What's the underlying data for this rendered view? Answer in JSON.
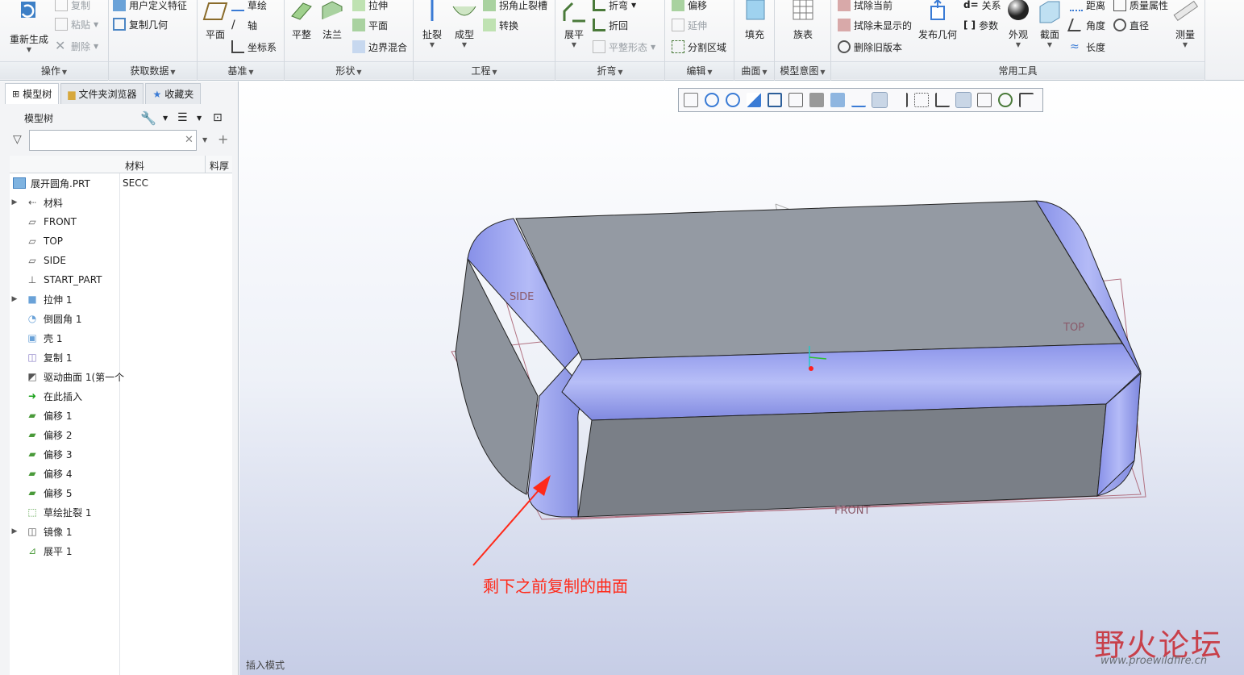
{
  "ribbon": {
    "groups": {
      "operations": "操作",
      "get_data": "获取数据",
      "datum": "基准",
      "shapes": "形状",
      "engineering": "工程",
      "bends": "折弯",
      "editing": "编辑",
      "surfaces": "曲面",
      "model_intent": "模型意图",
      "common_tools": "常用工具"
    },
    "operations": {
      "regenerate": "重新生成",
      "copy": "复制",
      "paste": "粘贴",
      "delete": "删除"
    },
    "get_data": {
      "udf": "用户定义特征",
      "copy_geom": "复制几何"
    },
    "datum": {
      "plane": "平面",
      "axis": "轴",
      "csys": "坐标系",
      "sketch": "草绘"
    },
    "shapes": {
      "flat": "平整",
      "flange": "法兰",
      "extrude": "拉伸",
      "planar": "平面",
      "boundary_blend": "边界混合"
    },
    "engineering": {
      "rip": "扯裂",
      "form": "成型",
      "corner_relief": "拐角止裂槽",
      "convert": "转换"
    },
    "bends": {
      "unbend": "展平",
      "bend": "折弯",
      "bend_back": "折回",
      "flat_state": "平整形态"
    },
    "editing": {
      "offset": "偏移",
      "extend": "延伸",
      "split_area": "分割区域"
    },
    "surfaces": {
      "fill": "填充"
    },
    "model_intent": {
      "family_table": "族表"
    },
    "common_tools": {
      "erase_current": "拭除当前",
      "erase_not_displayed": "拭除未显示的",
      "delete_old_versions": "删除旧版本",
      "publish_geom": "发布几何",
      "relations": "关系",
      "parameters": "参数",
      "appearance": "外观",
      "section": "截面",
      "distance": "距离",
      "angle": "角度",
      "length": "长度",
      "mass_props": "质量属性",
      "diameter": "直径",
      "measure": "测量"
    }
  },
  "panel": {
    "tabs": [
      "模型树",
      "文件夹浏览器",
      "收藏夹"
    ],
    "tree_title": "模型树",
    "filter_placeholder": "",
    "columns": {
      "material": "材料",
      "thickness": "料厚"
    }
  },
  "tree": {
    "root": {
      "name": "展开圆角.PRT",
      "material": "SECC"
    },
    "items": [
      {
        "label": "材料",
        "icon": "material-icon",
        "expand": true
      },
      {
        "label": "FRONT",
        "icon": "datum-plane-icon",
        "expand": false
      },
      {
        "label": "TOP",
        "icon": "datum-plane-icon",
        "expand": false
      },
      {
        "label": "SIDE",
        "icon": "datum-plane-icon",
        "expand": false
      },
      {
        "label": "START_PART",
        "icon": "csys-icon",
        "expand": false
      },
      {
        "label": "拉伸 1",
        "icon": "extrude-icon",
        "expand": true
      },
      {
        "label": "倒圆角 1",
        "icon": "round-icon",
        "expand": false
      },
      {
        "label": "壳 1",
        "icon": "shell-icon",
        "expand": false
      },
      {
        "label": "复制 1",
        "icon": "copy-surface-icon",
        "expand": false
      },
      {
        "label": "驱动曲面 1(第一个",
        "icon": "driving-surface-icon",
        "expand": false
      },
      {
        "label": "在此插入",
        "icon": "insert-here-icon",
        "expand": false
      },
      {
        "label": "偏移 1",
        "icon": "offset-icon",
        "expand": false
      },
      {
        "label": "偏移 2",
        "icon": "offset-icon",
        "expand": false
      },
      {
        "label": "偏移 3",
        "icon": "offset-icon",
        "expand": false
      },
      {
        "label": "偏移 4",
        "icon": "offset-icon",
        "expand": false
      },
      {
        "label": "偏移 5",
        "icon": "offset-icon",
        "expand": false
      },
      {
        "label": "草绘扯裂 1",
        "icon": "sketch-rip-icon",
        "expand": false
      },
      {
        "label": "镜像 1",
        "icon": "mirror-icon",
        "expand": true
      },
      {
        "label": "展平 1",
        "icon": "unbend-icon",
        "expand": false
      }
    ]
  },
  "viewport": {
    "datum_labels": {
      "side": "SIDE",
      "top": "TOP",
      "front": "FRONT"
    },
    "annotation": "剩下之前复制的曲面",
    "status": "插入模式",
    "watermark": {
      "brand": "野火论坛",
      "url": "www.proewildfire.cn"
    },
    "colors": {
      "face": "#8d939c",
      "round": "#a0a8f0",
      "arrow": "#ff2a1a",
      "datum": "#b06070"
    }
  }
}
